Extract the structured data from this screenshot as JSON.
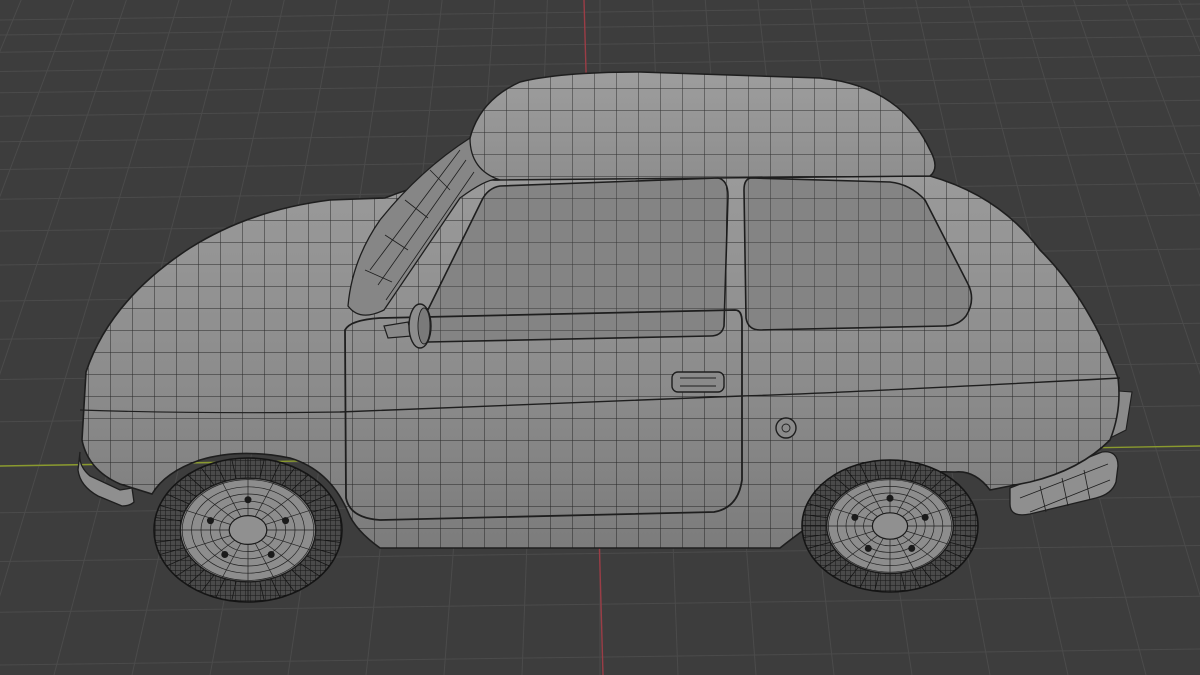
{
  "app": {
    "view": "3D Viewport",
    "shading": "solid",
    "overlay": "wireframe"
  },
  "colors": {
    "background": "#3d3d3d",
    "grid_line": "#4b4b4b",
    "x_axis": "#8a9a2e",
    "y_axis": "#9b3d46",
    "model_fill": "#8c8c8c",
    "glass_fill": "#838383",
    "wire": "#1e1e1e",
    "tire": "#4a4a4a"
  },
  "model": {
    "object": "car",
    "style": "small two-door hatchback",
    "components": [
      "body",
      "roof",
      "front-window",
      "rear-window",
      "door",
      "door-handle",
      "side-mirror",
      "front-bumper",
      "rear-bumper",
      "fuel-cap",
      "front-wheel",
      "rear-wheel"
    ]
  }
}
